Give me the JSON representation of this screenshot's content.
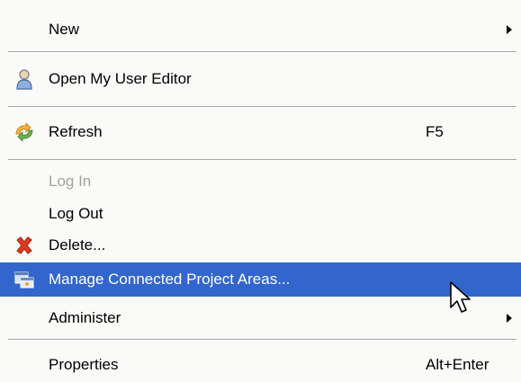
{
  "colors": {
    "menu_background": "#fafaf8",
    "highlight": "#3366cc",
    "highlight_text": "#ffffff",
    "disabled_text": "#a3a39b",
    "separator": "#a5a5a5"
  },
  "menu": {
    "items": [
      {
        "label": "New",
        "has_submenu": true
      },
      {
        "label": "Open My User Editor",
        "icon": "user-icon"
      },
      {
        "label": "Refresh",
        "icon": "refresh-icon",
        "shortcut": "F5"
      },
      {
        "label": "Log In",
        "disabled": true
      },
      {
        "label": "Log Out"
      },
      {
        "label": "Delete...",
        "icon": "delete-icon"
      },
      {
        "label": "Manage Connected Project Areas...",
        "icon": "project-areas-icon",
        "highlighted": true
      },
      {
        "label": "Administer",
        "has_submenu": true
      },
      {
        "label": "Properties",
        "shortcut": "Alt+Enter"
      }
    ]
  }
}
